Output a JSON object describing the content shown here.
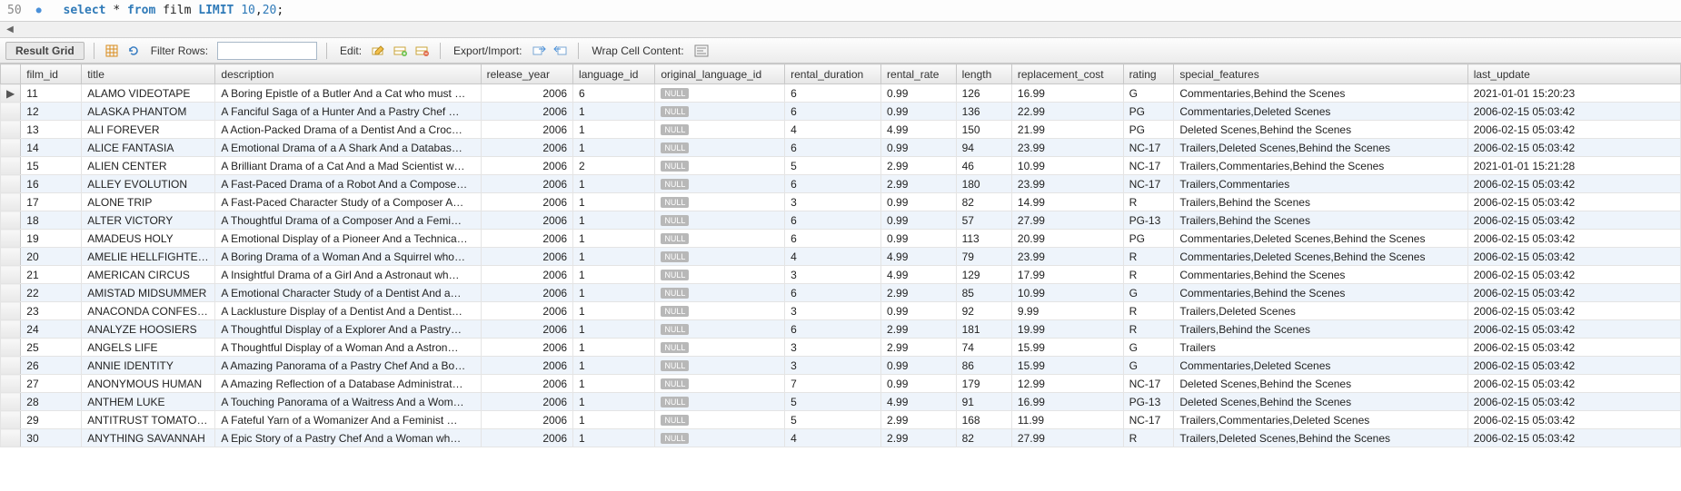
{
  "query": {
    "line_number": "50",
    "tokens": {
      "select": "select",
      "star": "*",
      "from": "from",
      "table": "film",
      "limit": "LIMIT",
      "offset": "10",
      "count": "20",
      "semi": ";"
    }
  },
  "toolbar": {
    "result_grid": "Result Grid",
    "filter_label": "Filter Rows:",
    "filter_value": "",
    "edit_label": "Edit:",
    "export_import_label": "Export/Import:",
    "wrap_label": "Wrap Cell Content:"
  },
  "columns": [
    "",
    "film_id",
    "title",
    "description",
    "release_year",
    "language_id",
    "original_language_id",
    "rental_duration",
    "rental_rate",
    "length",
    "replacement_cost",
    "rating",
    "special_features",
    "last_update"
  ],
  "null_label": "NULL",
  "rows": [
    {
      "ptr": "▶",
      "film_id": "11",
      "title": "ALAMO VIDEOTAPE",
      "description": "A Boring Epistle of a Butler And a Cat who must …",
      "release_year": "2006",
      "language_id": "6",
      "original_language_id": null,
      "rental_duration": "6",
      "rental_rate": "0.99",
      "length": "126",
      "replacement_cost": "16.99",
      "rating": "G",
      "special_features": "Commentaries,Behind the Scenes",
      "last_update": "2021-01-01 15:20:23"
    },
    {
      "ptr": "",
      "film_id": "12",
      "title": "ALASKA PHANTOM",
      "description": "A Fanciful Saga of a Hunter And a Pastry Chef …",
      "release_year": "2006",
      "language_id": "1",
      "original_language_id": null,
      "rental_duration": "6",
      "rental_rate": "0.99",
      "length": "136",
      "replacement_cost": "22.99",
      "rating": "PG",
      "special_features": "Commentaries,Deleted Scenes",
      "last_update": "2006-02-15 05:03:42"
    },
    {
      "ptr": "",
      "film_id": "13",
      "title": "ALI FOREVER",
      "description": "A Action-Packed Drama of a Dentist And a Croc…",
      "release_year": "2006",
      "language_id": "1",
      "original_language_id": null,
      "rental_duration": "4",
      "rental_rate": "4.99",
      "length": "150",
      "replacement_cost": "21.99",
      "rating": "PG",
      "special_features": "Deleted Scenes,Behind the Scenes",
      "last_update": "2006-02-15 05:03:42"
    },
    {
      "ptr": "",
      "film_id": "14",
      "title": "ALICE FANTASIA",
      "description": "A Emotional Drama of a A Shark And a Databas…",
      "release_year": "2006",
      "language_id": "1",
      "original_language_id": null,
      "rental_duration": "6",
      "rental_rate": "0.99",
      "length": "94",
      "replacement_cost": "23.99",
      "rating": "NC-17",
      "special_features": "Trailers,Deleted Scenes,Behind the Scenes",
      "last_update": "2006-02-15 05:03:42"
    },
    {
      "ptr": "",
      "film_id": "15",
      "title": "ALIEN CENTER",
      "description": "A Brilliant Drama of a Cat And a Mad Scientist w…",
      "release_year": "2006",
      "language_id": "2",
      "original_language_id": null,
      "rental_duration": "5",
      "rental_rate": "2.99",
      "length": "46",
      "replacement_cost": "10.99",
      "rating": "NC-17",
      "special_features": "Trailers,Commentaries,Behind the Scenes",
      "last_update": "2021-01-01 15:21:28"
    },
    {
      "ptr": "",
      "film_id": "16",
      "title": "ALLEY EVOLUTION",
      "description": "A Fast-Paced Drama of a Robot And a Compose…",
      "release_year": "2006",
      "language_id": "1",
      "original_language_id": null,
      "rental_duration": "6",
      "rental_rate": "2.99",
      "length": "180",
      "replacement_cost": "23.99",
      "rating": "NC-17",
      "special_features": "Trailers,Commentaries",
      "last_update": "2006-02-15 05:03:42"
    },
    {
      "ptr": "",
      "film_id": "17",
      "title": "ALONE TRIP",
      "description": "A Fast-Paced Character Study of a Composer A…",
      "release_year": "2006",
      "language_id": "1",
      "original_language_id": null,
      "rental_duration": "3",
      "rental_rate": "0.99",
      "length": "82",
      "replacement_cost": "14.99",
      "rating": "R",
      "special_features": "Trailers,Behind the Scenes",
      "last_update": "2006-02-15 05:03:42"
    },
    {
      "ptr": "",
      "film_id": "18",
      "title": "ALTER VICTORY",
      "description": "A Thoughtful Drama of a Composer And a Femi…",
      "release_year": "2006",
      "language_id": "1",
      "original_language_id": null,
      "rental_duration": "6",
      "rental_rate": "0.99",
      "length": "57",
      "replacement_cost": "27.99",
      "rating": "PG-13",
      "special_features": "Trailers,Behind the Scenes",
      "last_update": "2006-02-15 05:03:42"
    },
    {
      "ptr": "",
      "film_id": "19",
      "title": "AMADEUS HOLY",
      "description": "A Emotional Display of a Pioneer And a Technica…",
      "release_year": "2006",
      "language_id": "1",
      "original_language_id": null,
      "rental_duration": "6",
      "rental_rate": "0.99",
      "length": "113",
      "replacement_cost": "20.99",
      "rating": "PG",
      "special_features": "Commentaries,Deleted Scenes,Behind the Scenes",
      "last_update": "2006-02-15 05:03:42"
    },
    {
      "ptr": "",
      "film_id": "20",
      "title": "AMELIE HELLFIGHTERS",
      "description": "A Boring Drama of a Woman And a Squirrel who…",
      "release_year": "2006",
      "language_id": "1",
      "original_language_id": null,
      "rental_duration": "4",
      "rental_rate": "4.99",
      "length": "79",
      "replacement_cost": "23.99",
      "rating": "R",
      "special_features": "Commentaries,Deleted Scenes,Behind the Scenes",
      "last_update": "2006-02-15 05:03:42"
    },
    {
      "ptr": "",
      "film_id": "21",
      "title": "AMERICAN CIRCUS",
      "description": "A Insightful Drama of a Girl And a Astronaut wh…",
      "release_year": "2006",
      "language_id": "1",
      "original_language_id": null,
      "rental_duration": "3",
      "rental_rate": "4.99",
      "length": "129",
      "replacement_cost": "17.99",
      "rating": "R",
      "special_features": "Commentaries,Behind the Scenes",
      "last_update": "2006-02-15 05:03:42"
    },
    {
      "ptr": "",
      "film_id": "22",
      "title": "AMISTAD MIDSUMMER",
      "description": "A Emotional Character Study of a Dentist And a…",
      "release_year": "2006",
      "language_id": "1",
      "original_language_id": null,
      "rental_duration": "6",
      "rental_rate": "2.99",
      "length": "85",
      "replacement_cost": "10.99",
      "rating": "G",
      "special_features": "Commentaries,Behind the Scenes",
      "last_update": "2006-02-15 05:03:42"
    },
    {
      "ptr": "",
      "film_id": "23",
      "title": "ANACONDA CONFESS…",
      "description": "A Lacklusture Display of a Dentist And a Dentist…",
      "release_year": "2006",
      "language_id": "1",
      "original_language_id": null,
      "rental_duration": "3",
      "rental_rate": "0.99",
      "length": "92",
      "replacement_cost": "9.99",
      "rating": "R",
      "special_features": "Trailers,Deleted Scenes",
      "last_update": "2006-02-15 05:03:42"
    },
    {
      "ptr": "",
      "film_id": "24",
      "title": "ANALYZE HOOSIERS",
      "description": "A Thoughtful Display of a Explorer And a Pastry…",
      "release_year": "2006",
      "language_id": "1",
      "original_language_id": null,
      "rental_duration": "6",
      "rental_rate": "2.99",
      "length": "181",
      "replacement_cost": "19.99",
      "rating": "R",
      "special_features": "Trailers,Behind the Scenes",
      "last_update": "2006-02-15 05:03:42"
    },
    {
      "ptr": "",
      "film_id": "25",
      "title": "ANGELS LIFE",
      "description": "A Thoughtful Display of a Woman And a Astron…",
      "release_year": "2006",
      "language_id": "1",
      "original_language_id": null,
      "rental_duration": "3",
      "rental_rate": "2.99",
      "length": "74",
      "replacement_cost": "15.99",
      "rating": "G",
      "special_features": "Trailers",
      "last_update": "2006-02-15 05:03:42"
    },
    {
      "ptr": "",
      "film_id": "26",
      "title": "ANNIE IDENTITY",
      "description": "A Amazing Panorama of a Pastry Chef And a Bo…",
      "release_year": "2006",
      "language_id": "1",
      "original_language_id": null,
      "rental_duration": "3",
      "rental_rate": "0.99",
      "length": "86",
      "replacement_cost": "15.99",
      "rating": "G",
      "special_features": "Commentaries,Deleted Scenes",
      "last_update": "2006-02-15 05:03:42"
    },
    {
      "ptr": "",
      "film_id": "27",
      "title": "ANONYMOUS HUMAN",
      "description": "A Amazing Reflection of a Database Administrat…",
      "release_year": "2006",
      "language_id": "1",
      "original_language_id": null,
      "rental_duration": "7",
      "rental_rate": "0.99",
      "length": "179",
      "replacement_cost": "12.99",
      "rating": "NC-17",
      "special_features": "Deleted Scenes,Behind the Scenes",
      "last_update": "2006-02-15 05:03:42"
    },
    {
      "ptr": "",
      "film_id": "28",
      "title": "ANTHEM LUKE",
      "description": "A Touching Panorama of a Waitress And a Wom…",
      "release_year": "2006",
      "language_id": "1",
      "original_language_id": null,
      "rental_duration": "5",
      "rental_rate": "4.99",
      "length": "91",
      "replacement_cost": "16.99",
      "rating": "PG-13",
      "special_features": "Deleted Scenes,Behind the Scenes",
      "last_update": "2006-02-15 05:03:42"
    },
    {
      "ptr": "",
      "film_id": "29",
      "title": "ANTITRUST TOMATOES",
      "description": "A Fateful Yarn of a Womanizer And a Feminist …",
      "release_year": "2006",
      "language_id": "1",
      "original_language_id": null,
      "rental_duration": "5",
      "rental_rate": "2.99",
      "length": "168",
      "replacement_cost": "11.99",
      "rating": "NC-17",
      "special_features": "Trailers,Commentaries,Deleted Scenes",
      "last_update": "2006-02-15 05:03:42"
    },
    {
      "ptr": "",
      "film_id": "30",
      "title": "ANYTHING SAVANNAH",
      "description": "A Epic Story of a Pastry Chef And a Woman wh…",
      "release_year": "2006",
      "language_id": "1",
      "original_language_id": null,
      "rental_duration": "4",
      "rental_rate": "2.99",
      "length": "82",
      "replacement_cost": "27.99",
      "rating": "R",
      "special_features": "Trailers,Deleted Scenes,Behind the Scenes",
      "last_update": "2006-02-15 05:03:42"
    }
  ]
}
